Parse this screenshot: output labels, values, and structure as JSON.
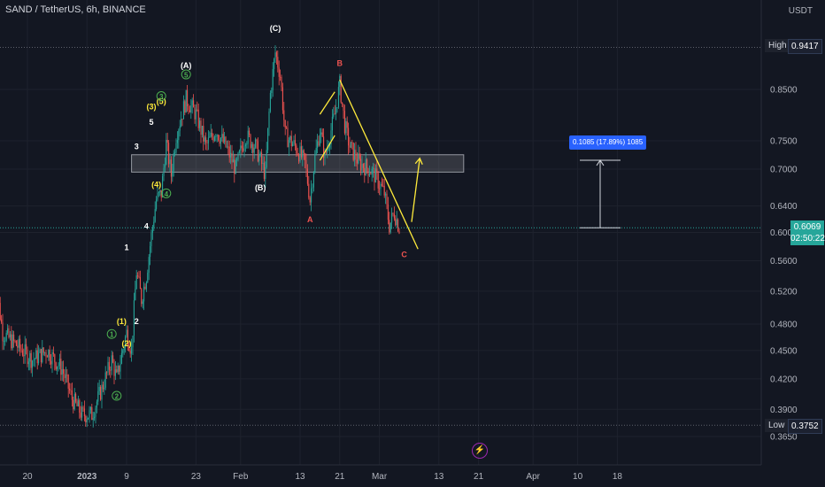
{
  "header": {
    "symbol_title": "SAND / TetherUS, 6h, BINANCE",
    "currency": "USDT"
  },
  "high_marker": {
    "label": "High",
    "value": "0.9417"
  },
  "low_marker": {
    "label": "Low",
    "value": "0.3752"
  },
  "last_price": {
    "value": "0.6069",
    "countdown": "02:50:22"
  },
  "measure": {
    "text": "0.1085 (17.89%) 1085"
  },
  "event_icon": "lightning-bolt-icon",
  "colors": {
    "background": "#131722",
    "grid": "#1e222d",
    "up": "#26a69a",
    "down": "#ef5350",
    "annotation_yellow": "#ffeb3b",
    "annotation_green": "#4caf50",
    "measure_blue": "#2962ff"
  },
  "chart_data": {
    "type": "candlestick",
    "title": "SAND / TetherUS, 6h, BINANCE",
    "log_scale": true,
    "grid": true,
    "y_ticks": [
      "0.3650",
      "0.3900",
      "0.4200",
      "0.4500",
      "0.4800",
      "0.5200",
      "0.5600",
      "0.6000",
      "0.6400",
      "0.7000",
      "0.7500",
      "0.8500"
    ],
    "x_ticks": [
      "20",
      "2023",
      "9",
      "23",
      "Feb",
      "13",
      "21",
      "Mar",
      "13",
      "21",
      "Apr",
      "10",
      "18"
    ],
    "close_series": [
      {
        "x": "2022-12-13",
        "y": 0.555
      },
      {
        "x": "2022-12-15",
        "y": 0.47
      },
      {
        "x": "2022-12-18",
        "y": 0.455
      },
      {
        "x": "2022-12-21",
        "y": 0.44
      },
      {
        "x": "2022-12-24",
        "y": 0.45
      },
      {
        "x": "2022-12-27",
        "y": 0.43
      },
      {
        "x": "2022-12-29",
        "y": 0.4
      },
      {
        "x": "2022-12-31",
        "y": 0.385
      },
      {
        "x": "2023-01-02",
        "y": 0.385
      },
      {
        "x": "2023-01-04",
        "y": 0.41
      },
      {
        "x": "2023-01-06",
        "y": 0.44
      },
      {
        "x": "2023-01-07",
        "y": 0.42
      },
      {
        "x": "2023-01-09",
        "y": 0.47
      },
      {
        "x": "2023-01-10",
        "y": 0.45
      },
      {
        "x": "2023-01-11",
        "y": 0.545
      },
      {
        "x": "2023-01-12",
        "y": 0.51
      },
      {
        "x": "2023-01-13",
        "y": 0.54
      },
      {
        "x": "2023-01-15",
        "y": 0.65
      },
      {
        "x": "2023-01-16",
        "y": 0.66
      },
      {
        "x": "2023-01-17",
        "y": 0.745
      },
      {
        "x": "2023-01-18",
        "y": 0.69
      },
      {
        "x": "2023-01-19",
        "y": 0.76
      },
      {
        "x": "2023-01-21",
        "y": 0.83
      },
      {
        "x": "2023-01-23",
        "y": 0.8
      },
      {
        "x": "2023-01-25",
        "y": 0.74
      },
      {
        "x": "2023-01-27",
        "y": 0.77
      },
      {
        "x": "2023-01-29",
        "y": 0.74
      },
      {
        "x": "2023-01-31",
        "y": 0.7
      },
      {
        "x": "2023-02-02",
        "y": 0.76
      },
      {
        "x": "2023-02-04",
        "y": 0.74
      },
      {
        "x": "2023-02-06",
        "y": 0.69
      },
      {
        "x": "2023-02-07",
        "y": 0.84
      },
      {
        "x": "2023-02-08",
        "y": 0.93
      },
      {
        "x": "2023-02-09",
        "y": 0.88
      },
      {
        "x": "2023-02-10",
        "y": 0.76
      },
      {
        "x": "2023-02-12",
        "y": 0.74
      },
      {
        "x": "2023-02-14",
        "y": 0.71
      },
      {
        "x": "2023-02-15",
        "y": 0.65
      },
      {
        "x": "2023-02-16",
        "y": 0.72
      },
      {
        "x": "2023-02-17",
        "y": 0.77
      },
      {
        "x": "2023-02-18",
        "y": 0.72
      },
      {
        "x": "2023-02-20",
        "y": 0.8
      },
      {
        "x": "2023-02-21",
        "y": 0.86
      },
      {
        "x": "2023-02-22",
        "y": 0.78
      },
      {
        "x": "2023-02-23",
        "y": 0.74
      },
      {
        "x": "2023-02-25",
        "y": 0.71
      },
      {
        "x": "2023-02-27",
        "y": 0.7
      },
      {
        "x": "2023-02-28",
        "y": 0.69
      },
      {
        "x": "2023-03-02",
        "y": 0.66
      },
      {
        "x": "2023-03-03",
        "y": 0.61
      },
      {
        "x": "2023-03-04",
        "y": 0.63
      },
      {
        "x": "2023-03-05",
        "y": 0.607
      }
    ],
    "high": 0.9417,
    "low": 0.3752,
    "last_price": 0.6069,
    "resistance_zone": {
      "from_date": "2023-01-10",
      "to_date": "2023-03-18",
      "low": 0.695,
      "high": 0.725
    },
    "trendline": {
      "start": {
        "x": "2023-02-21",
        "y": 0.87
      },
      "end": {
        "x": "2023-03-07",
        "y": 0.58
      }
    },
    "projection_arrow": {
      "from": {
        "x": "2023-03-05",
        "y": 0.605
      },
      "to": {
        "x": "2023-03-07",
        "y": 0.725
      }
    },
    "price_range_measure": {
      "from_price": 0.6069,
      "to_price": 0.7154,
      "text": "0.1085 (17.89%) 1085"
    },
    "wave_labels": [
      {
        "text": "(C)",
        "x": "2023-02-08",
        "y": 0.98,
        "color": "white"
      },
      {
        "text": "(A)",
        "x": "2023-01-21",
        "y": 0.895,
        "color": "white"
      },
      {
        "text": "(B)",
        "x": "2023-02-05",
        "y": 0.665,
        "color": "white"
      },
      {
        "text": "B",
        "x": "2023-02-21",
        "y": 0.9,
        "color": "red"
      },
      {
        "text": "A",
        "x": "2023-02-15",
        "y": 0.615,
        "color": "red"
      },
      {
        "text": "C",
        "x": "2023-03-06",
        "y": 0.565,
        "color": "red"
      },
      {
        "text": "5",
        "x": "2023-01-14",
        "y": 0.78,
        "color": "white"
      },
      {
        "text": "3",
        "x": "2023-01-11",
        "y": 0.735,
        "color": "white"
      },
      {
        "text": "4",
        "x": "2023-01-13",
        "y": 0.605,
        "color": "white"
      },
      {
        "text": "1",
        "x": "2023-01-09",
        "y": 0.575,
        "color": "white"
      },
      {
        "text": "2",
        "x": "2023-01-11",
        "y": 0.48,
        "color": "white"
      },
      {
        "text": "(3)",
        "x": "2023-01-14",
        "y": 0.81,
        "color": "yellow"
      },
      {
        "text": "(5)",
        "x": "2023-01-16",
        "y": 0.82,
        "color": "yellow"
      },
      {
        "text": "(4)",
        "x": "2023-01-15",
        "y": 0.67,
        "color": "yellow"
      },
      {
        "text": "(1)",
        "x": "2023-01-08",
        "y": 0.48,
        "color": "yellow"
      },
      {
        "text": "(2)",
        "x": "2023-01-09",
        "y": 0.455,
        "color": "yellow"
      },
      {
        "text": "5",
        "x": "2023-01-21",
        "y": 0.875,
        "color": "green",
        "circled": true
      },
      {
        "text": "3",
        "x": "2023-01-16",
        "y": 0.83,
        "color": "green",
        "circled": true
      },
      {
        "text": "4",
        "x": "2023-01-17",
        "y": 0.655,
        "color": "green",
        "circled": true
      },
      {
        "text": "1",
        "x": "2023-01-06",
        "y": 0.465,
        "color": "green",
        "circled": true
      },
      {
        "text": "2",
        "x": "2023-01-07",
        "y": 0.4,
        "color": "green",
        "circled": true
      }
    ]
  }
}
